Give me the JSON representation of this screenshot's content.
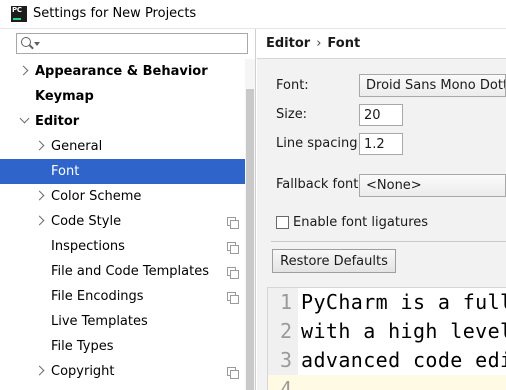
{
  "window": {
    "title": "Settings for New Projects",
    "logo_text": "PC"
  },
  "search": {
    "value": "",
    "placeholder": ""
  },
  "tree": {
    "items": [
      {
        "label": "Appearance & Behavior"
      },
      {
        "label": "Keymap"
      },
      {
        "label": "Editor"
      },
      {
        "label": "General"
      },
      {
        "label": "Font"
      },
      {
        "label": "Color Scheme"
      },
      {
        "label": "Code Style"
      },
      {
        "label": "Inspections"
      },
      {
        "label": "File and Code Templates"
      },
      {
        "label": "File Encodings"
      },
      {
        "label": "Live Templates"
      },
      {
        "label": "File Types"
      },
      {
        "label": "Copyright"
      }
    ],
    "selected": "Font"
  },
  "breadcrumb": {
    "parent": "Editor",
    "separator": "›",
    "current": "Font"
  },
  "form": {
    "font_label": "Font:",
    "font_value": "Droid Sans Mono Dotted",
    "size_label": "Size:",
    "size_value": "20",
    "line_spacing_label": "Line spacing:",
    "line_spacing_value": "1.2",
    "fallback_label": "Fallback font:",
    "fallback_value": "<None>",
    "ligatures_label": "Enable font ligatures",
    "ligatures_checked": false,
    "restore_button": "Restore Defaults"
  },
  "preview": {
    "lines": [
      {
        "number": "1",
        "text": "PyCharm is a full"
      },
      {
        "number": "2",
        "text": "with a high level"
      },
      {
        "number": "3",
        "text": "advanced code edit"
      },
      {
        "number": "4",
        "text": ""
      }
    ]
  },
  "colors": {
    "selection": "#2f65ca",
    "panel_background": "#f2f2f2",
    "current_line": "#fffae3",
    "logo_accent": "#21d789"
  },
  "icons": [
    "search-icon",
    "expand-arrow-icon",
    "collapse-arrow-icon",
    "project-scope-icon",
    "app-logo-icon"
  ]
}
